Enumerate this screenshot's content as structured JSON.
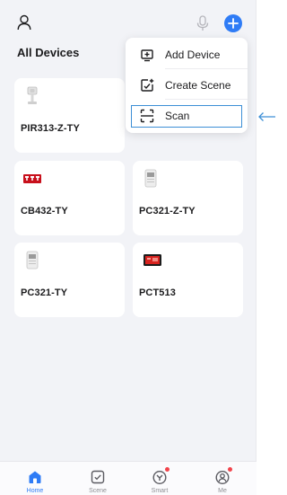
{
  "header": {
    "section_title": "All Devices",
    "icons": [
      "user-icon",
      "microphone-icon",
      "add-circle-icon"
    ],
    "accent": "#2f7cf6"
  },
  "devices": [
    {
      "name": "PIR313-Z-TY",
      "icon": "motion-sensor-icon"
    },
    {
      "name": "CB432-TY",
      "icon": "smart-switch-module-icon"
    },
    {
      "name": "PC321-Z-TY",
      "icon": "power-meter-icon"
    },
    {
      "name": "PC321-TY",
      "icon": "power-meter-icon"
    },
    {
      "name": "PCT513",
      "icon": "thermostat-icon"
    }
  ],
  "dropdown": {
    "items": [
      {
        "label": "Add Device",
        "icon": "add-device-icon"
      },
      {
        "label": "Create Scene",
        "icon": "create-scene-icon"
      },
      {
        "label": "Scan",
        "icon": "scan-icon",
        "highlighted": true
      }
    ],
    "highlight_color": "#3d8fd6"
  },
  "bottom_nav": [
    {
      "label": "Home",
      "icon": "home-icon",
      "active": true
    },
    {
      "label": "Scene",
      "icon": "scene-icon",
      "active": false
    },
    {
      "label": "Smart",
      "icon": "smart-icon",
      "badge": true
    },
    {
      "label": "Me",
      "icon": "me-icon",
      "badge": true
    }
  ],
  "badge_color": "#f2434b"
}
